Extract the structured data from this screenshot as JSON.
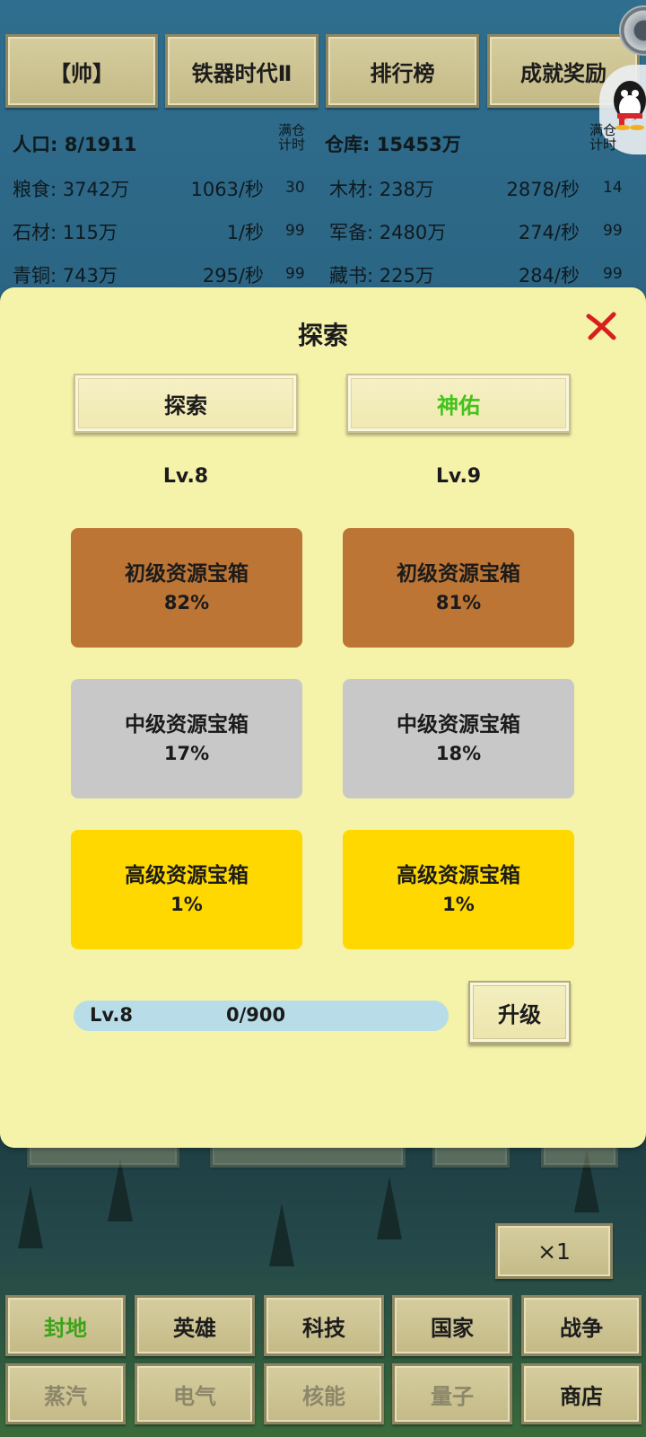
{
  "top_tabs": [
    {
      "label": "【帅】"
    },
    {
      "label": "铁器时代Ⅱ"
    },
    {
      "label": "排行榜"
    },
    {
      "label": "成就奖励"
    }
  ],
  "resources": {
    "population_label": "人口: 8/1911",
    "warehouse_label": "仓库: 15453万",
    "full_timer_label_left": "满仓\n计时",
    "full_timer_label_right": "满仓\n计时",
    "left": [
      {
        "name": "粮食: 3742万",
        "rate": "1063/秒",
        "timer": "30"
      },
      {
        "name": "石材: 115万",
        "rate": "1/秒",
        "timer": "99"
      },
      {
        "name": "青铜: 743万",
        "rate": "295/秒",
        "timer": "99"
      }
    ],
    "right": [
      {
        "name": "木材: 238万",
        "rate": "2878/秒",
        "timer": "14"
      },
      {
        "name": "军备: 2480万",
        "rate": "274/秒",
        "timer": "99"
      },
      {
        "name": "藏书: 225万",
        "rate": "284/秒",
        "timer": "99"
      }
    ]
  },
  "modal": {
    "title": "探索",
    "tabs": [
      {
        "label": "探索",
        "level": "Lv.8"
      },
      {
        "label": "神佑",
        "level": "Lv.9"
      }
    ],
    "chests_left": [
      {
        "name": "初级资源宝箱",
        "pct": "82%"
      },
      {
        "name": "中级资源宝箱",
        "pct": "17%"
      },
      {
        "name": "高级资源宝箱",
        "pct": "1%"
      }
    ],
    "chests_right": [
      {
        "name": "初级资源宝箱",
        "pct": "81%"
      },
      {
        "name": "中级资源宝箱",
        "pct": "18%"
      },
      {
        "name": "高级资源宝箱",
        "pct": "1%"
      }
    ],
    "progress": {
      "level": "Lv.8",
      "text": "0/900",
      "fraction": 0
    },
    "upgrade_label": "升级"
  },
  "speed_label": "×1",
  "bottom_nav_row1": [
    {
      "label": "封地",
      "state": "active"
    },
    {
      "label": "英雄",
      "state": "normal"
    },
    {
      "label": "科技",
      "state": "normal"
    },
    {
      "label": "国家",
      "state": "normal"
    },
    {
      "label": "战争",
      "state": "normal"
    }
  ],
  "bottom_nav_row2": [
    {
      "label": "蒸汽",
      "state": "disabled"
    },
    {
      "label": "电气",
      "state": "disabled"
    },
    {
      "label": "核能",
      "state": "disabled"
    },
    {
      "label": "量子",
      "state": "disabled"
    },
    {
      "label": "商店",
      "state": "normal"
    }
  ],
  "colors": {
    "modal_bg": "#f5f2a9",
    "active_tab_text": "#43c21b",
    "active_nav_text": "#3ca319",
    "chest_bronze": "#bc7535",
    "chest_silver": "#c8c8c8",
    "chest_gold": "#ffd800",
    "close_icon": "#d81e1e"
  },
  "icons": [
    "close-icon",
    "settings-circle-icon",
    "qq-penguin-icon"
  ]
}
